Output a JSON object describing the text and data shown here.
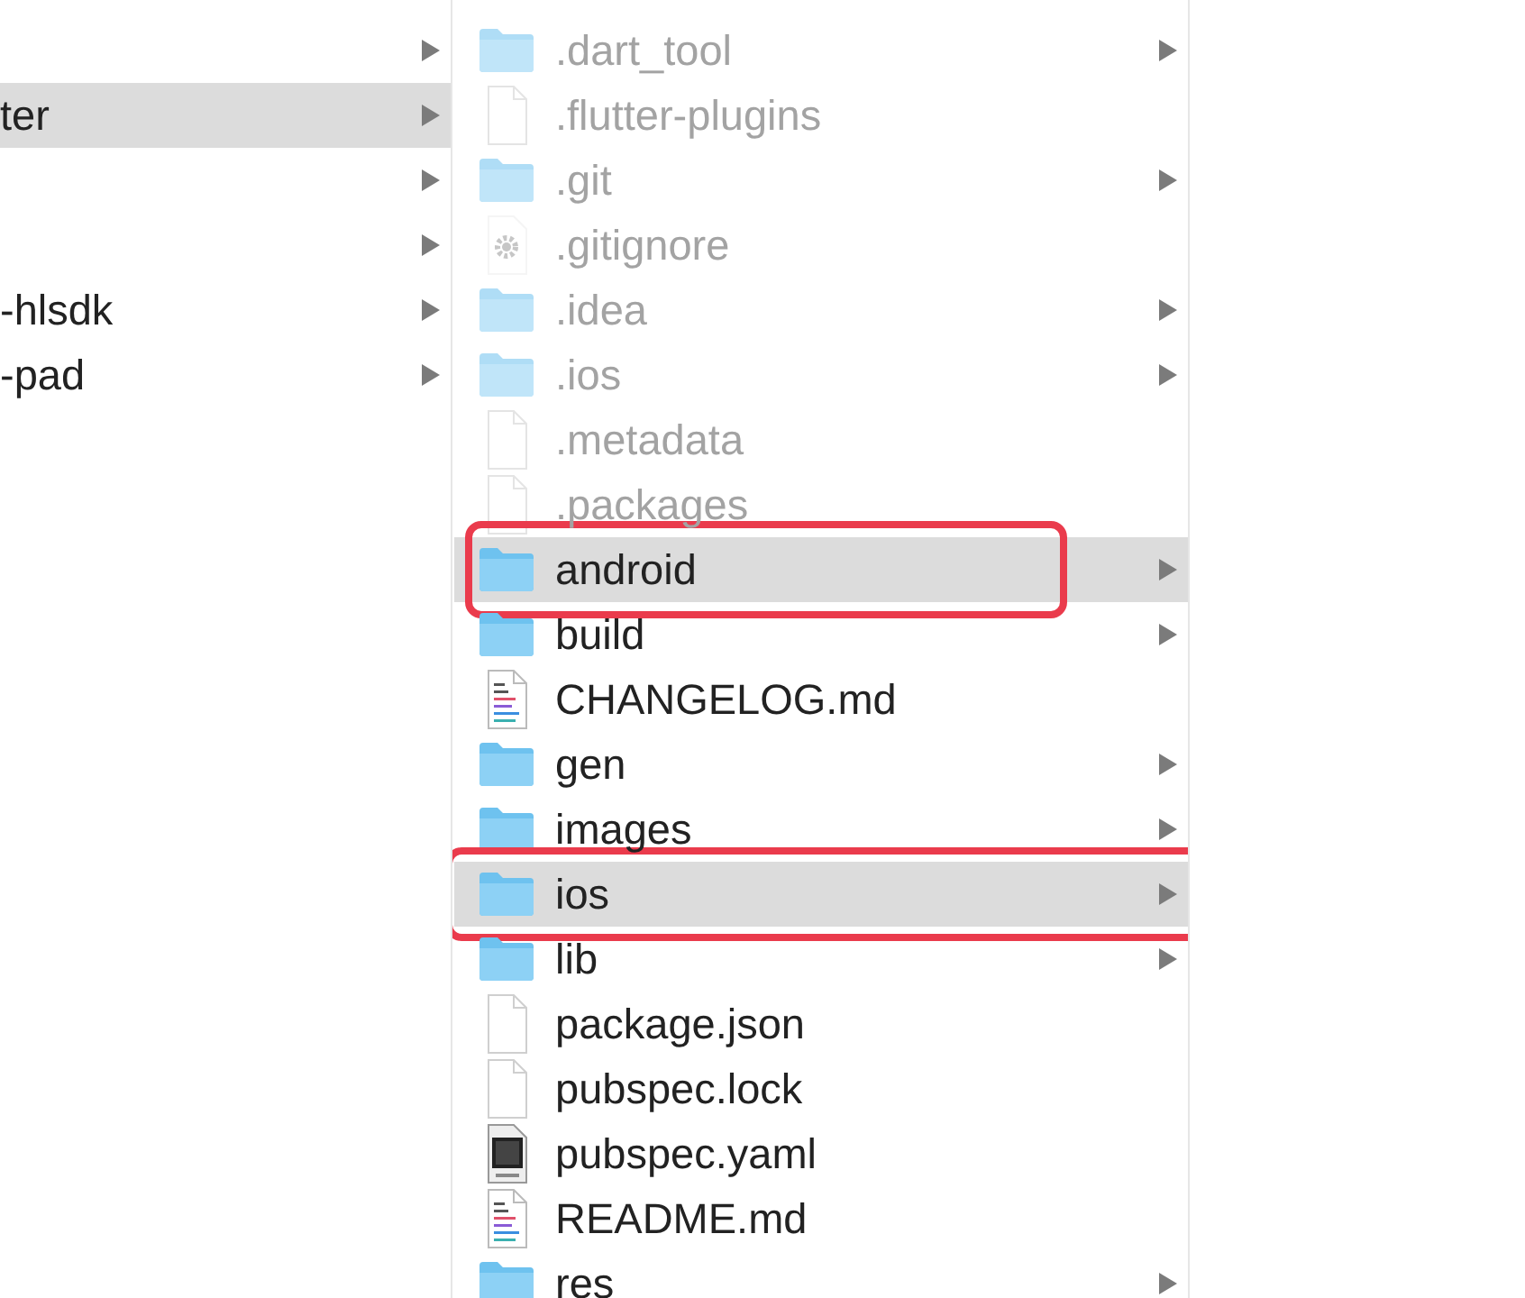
{
  "columns": [
    {
      "items": [
        {
          "has_children": true,
          "selected": false
        },
        {
          "name": "ter",
          "has_children": true,
          "selected": true
        },
        {
          "has_children": true,
          "selected": false
        },
        {
          "has_children": true,
          "selected": false
        },
        {
          "name": "-hlsdk",
          "has_children": true,
          "selected": false
        },
        {
          "name": "-pad",
          "has_children": true,
          "selected": false
        }
      ]
    },
    {
      "items": [
        {
          "name": ".dart_tool",
          "kind": "folder",
          "hidden": true,
          "has_children": true,
          "selected": false
        },
        {
          "name": ".flutter-plugins",
          "kind": "file",
          "hidden": true,
          "has_children": false,
          "selected": false
        },
        {
          "name": ".git",
          "kind": "folder",
          "hidden": true,
          "has_children": true,
          "selected": false
        },
        {
          "name": ".gitignore",
          "kind": "settings",
          "hidden": true,
          "has_children": false,
          "selected": false
        },
        {
          "name": ".idea",
          "kind": "folder",
          "hidden": true,
          "has_children": true,
          "selected": false
        },
        {
          "name": ".ios",
          "kind": "folder",
          "hidden": true,
          "has_children": true,
          "selected": false
        },
        {
          "name": ".metadata",
          "kind": "file",
          "hidden": true,
          "has_children": false,
          "selected": false
        },
        {
          "name": ".packages",
          "kind": "file",
          "hidden": true,
          "has_children": false,
          "selected": false
        },
        {
          "name": "android",
          "kind": "folder",
          "hidden": false,
          "has_children": true,
          "selected": true,
          "annotated": true
        },
        {
          "name": "build",
          "kind": "folder",
          "hidden": false,
          "has_children": true,
          "selected": false
        },
        {
          "name": "CHANGELOG.md",
          "kind": "text",
          "hidden": false,
          "has_children": false,
          "selected": false
        },
        {
          "name": "gen",
          "kind": "folder",
          "hidden": false,
          "has_children": true,
          "selected": false
        },
        {
          "name": "images",
          "kind": "folder",
          "hidden": false,
          "has_children": true,
          "selected": false
        },
        {
          "name": "ios",
          "kind": "folder",
          "hidden": false,
          "has_children": true,
          "selected": true,
          "annotated": true
        },
        {
          "name": "lib",
          "kind": "folder",
          "hidden": false,
          "has_children": true,
          "selected": false
        },
        {
          "name": "package.json",
          "kind": "file",
          "hidden": false,
          "has_children": false,
          "selected": false
        },
        {
          "name": "pubspec.lock",
          "kind": "file",
          "hidden": false,
          "has_children": false,
          "selected": false
        },
        {
          "name": "pubspec.yaml",
          "kind": "yaml",
          "hidden": false,
          "has_children": false,
          "selected": false
        },
        {
          "name": "README.md",
          "kind": "text",
          "hidden": false,
          "has_children": false,
          "selected": false
        },
        {
          "name": "res",
          "kind": "folder",
          "hidden": false,
          "has_children": true,
          "selected": false
        }
      ]
    }
  ]
}
